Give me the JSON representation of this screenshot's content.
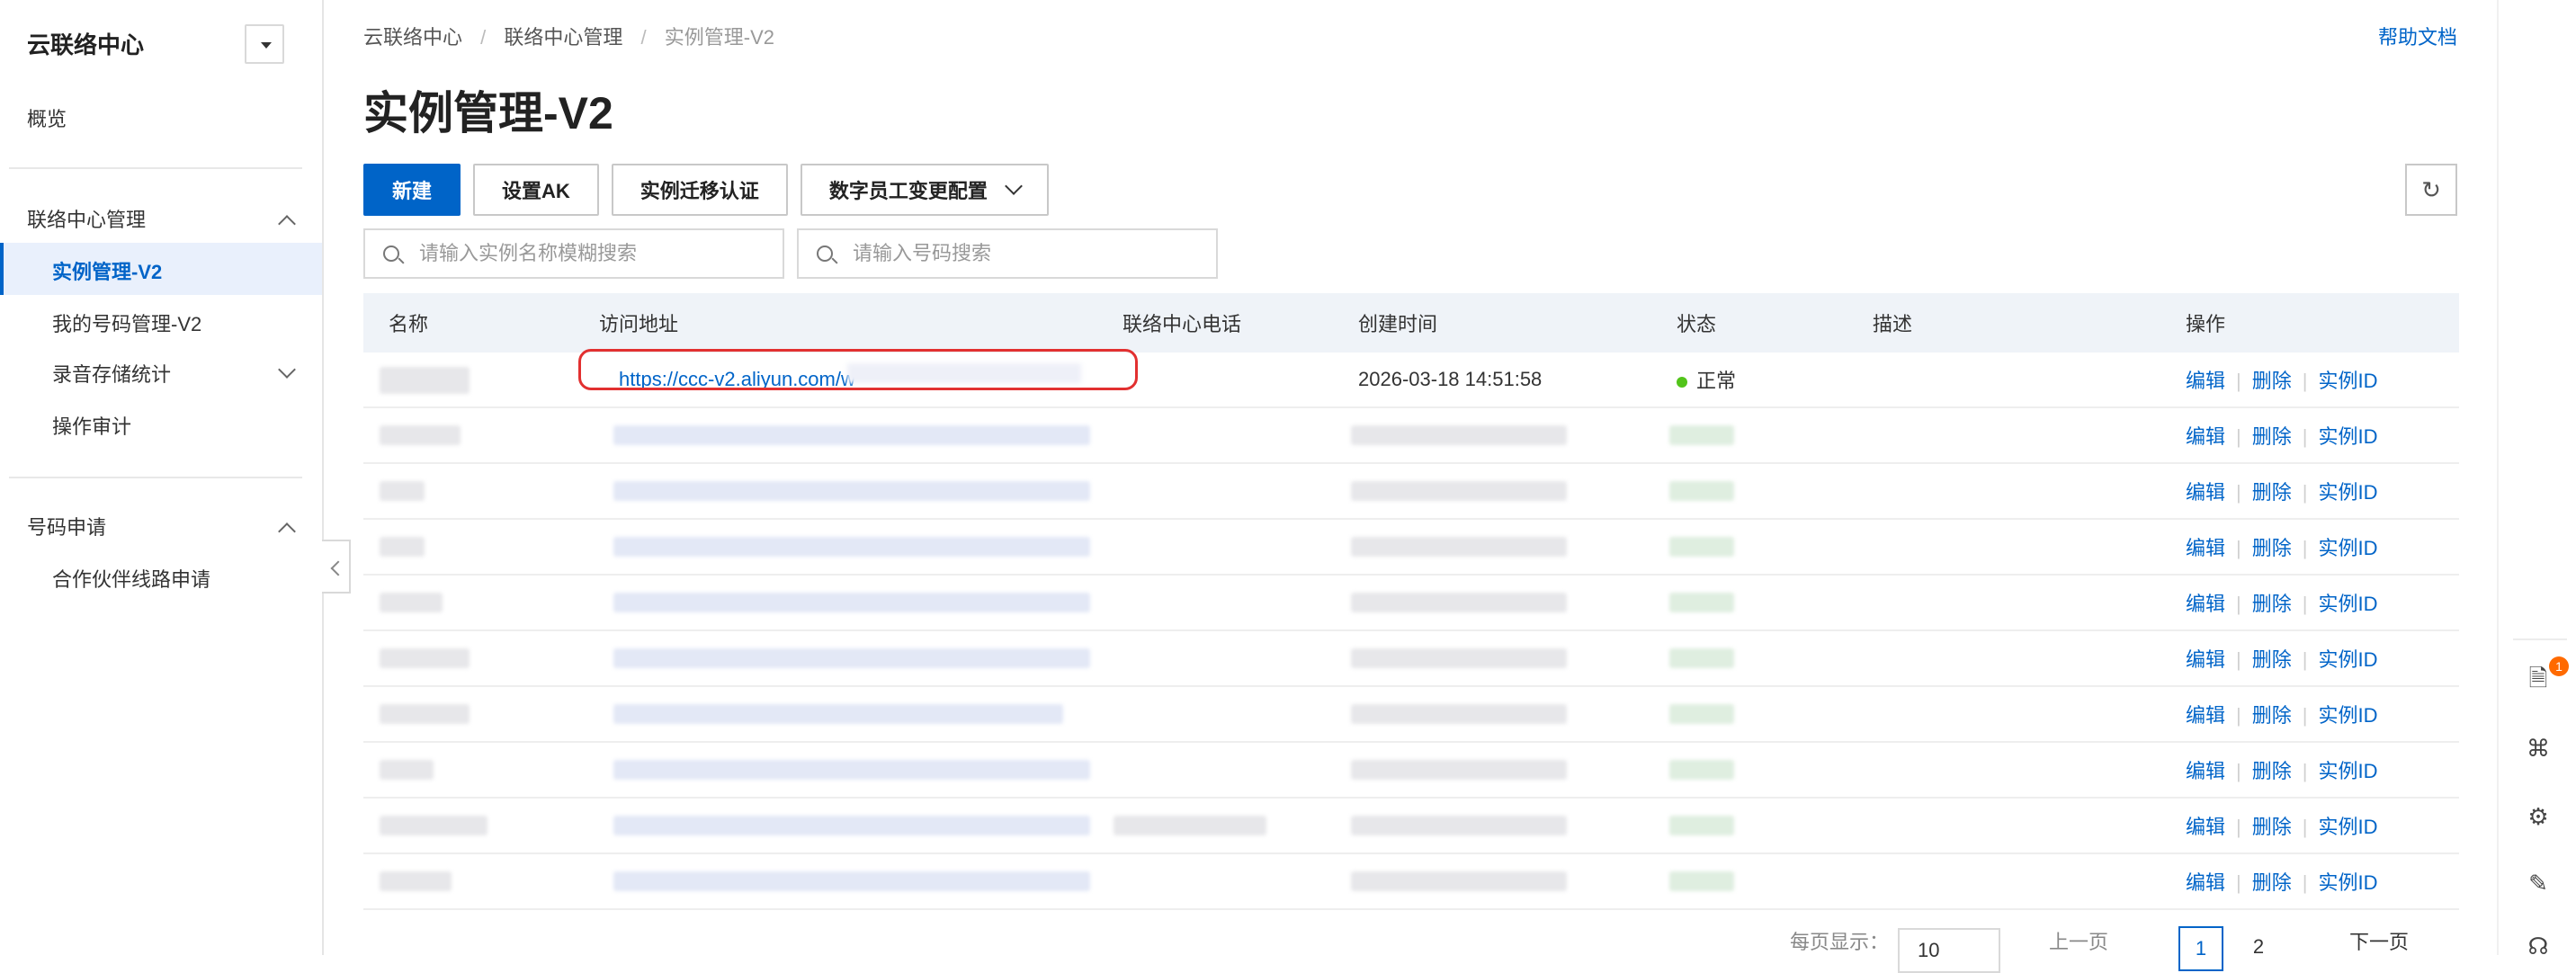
{
  "sidebar": {
    "title": "云联络中心",
    "overview": "概览",
    "groups": [
      {
        "label": "联络中心管理",
        "items": [
          "实例管理-V2",
          "我的号码管理-V2",
          "录音存储统计",
          "操作审计"
        ]
      },
      {
        "label": "号码申请",
        "items": [
          "合作伙伴线路申请"
        ]
      }
    ]
  },
  "breadcrumb": {
    "a": "云联络中心",
    "b": "联络中心管理",
    "c": "实例管理-V2",
    "sep": "/"
  },
  "help": "帮助文档",
  "page_title": "实例管理-V2",
  "toolbar": {
    "new": "新建",
    "set_ak": "设置AK",
    "migrate": "实例迁移认证",
    "digital_config": "数字员工变更配置",
    "refresh_icon": "↻"
  },
  "search": {
    "name_placeholder": "请输入实例名称模糊搜索",
    "phone_placeholder": "请输入号码搜索"
  },
  "table": {
    "headers": {
      "name": "名称",
      "url": "访问地址",
      "phone": "联络中心电话",
      "time": "创建时间",
      "state": "状态",
      "desc": "描述",
      "ops": "操作"
    },
    "first_row": {
      "url": "https://ccc-v2.aliyun.com/w",
      "time": "2026-03-18 14:51:58",
      "state": "正常"
    },
    "ops": {
      "edit": "编辑",
      "delete": "删除",
      "id": "实例ID"
    }
  },
  "pagination": {
    "per_page_label": "每页显示：",
    "per_page": "10",
    "prev": "上一页",
    "pages": [
      "1",
      "2"
    ],
    "next": "下一页"
  },
  "rail": {
    "badge": "1"
  },
  "colors": {
    "primary": "#0064c8",
    "highlight": "#e23030",
    "status_ok": "#52c41a"
  }
}
